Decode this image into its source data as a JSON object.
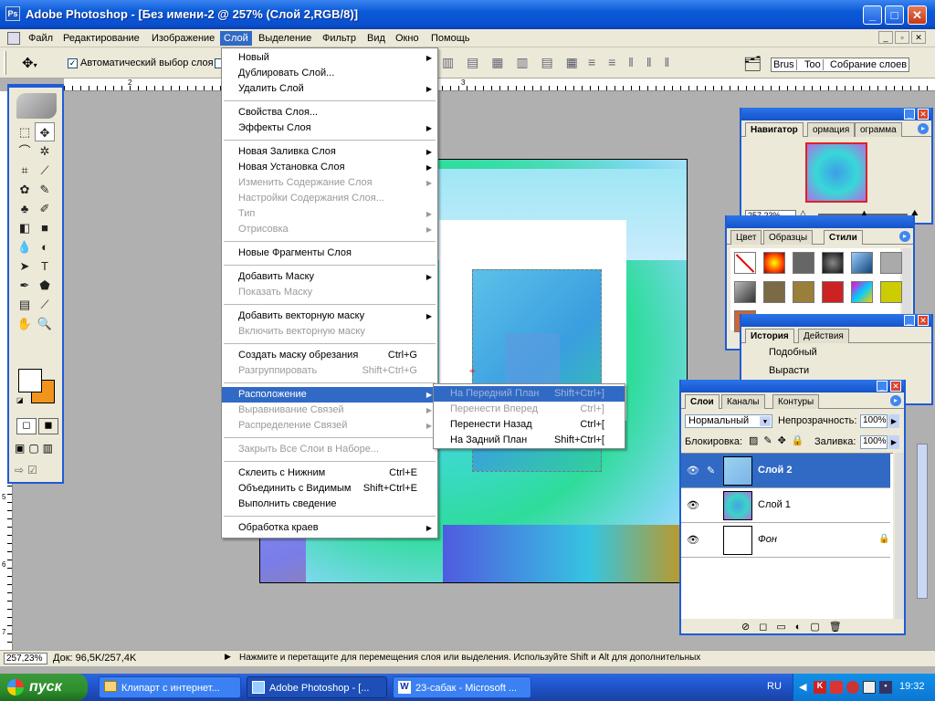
{
  "window": {
    "title": "Adobe Photoshop - [Без имени-2 @ 257% (Слой 2,RGB/8)]",
    "min": "_",
    "max": "□",
    "close": "✕"
  },
  "menubar": {
    "items": [
      "Файл",
      "Редактирование",
      "Изображение",
      "Слой",
      "Выделение",
      "Фильтр",
      "Вид",
      "Окно",
      "Помощь"
    ],
    "active_index": 3
  },
  "options": {
    "auto_select_label": "Автоматический выбор слоя",
    "well_tabs": [
      "Brus",
      "Too",
      "Собрание слоев"
    ]
  },
  "ruler_top": [
    "2",
    "3"
  ],
  "ruler_left": [
    "5",
    "6",
    "7"
  ],
  "layer_menu": {
    "items": [
      {
        "label": "Новый",
        "shortcut": "",
        "sub": true,
        "disabled": false
      },
      {
        "label": "Дублировать Слой...",
        "shortcut": "",
        "sub": false,
        "disabled": false
      },
      {
        "label": "Удалить Слой",
        "shortcut": "",
        "sub": true,
        "disabled": false
      },
      {
        "label": "Свойства Слоя...",
        "shortcut": "",
        "sub": false,
        "disabled": false
      },
      {
        "label": "Эффекты Слоя",
        "shortcut": "",
        "sub": true,
        "disabled": false
      },
      {
        "label": "Новая Заливка Слоя",
        "shortcut": "",
        "sub": true,
        "disabled": false
      },
      {
        "label": "Новая Установка Слоя",
        "shortcut": "",
        "sub": true,
        "disabled": false
      },
      {
        "label": "Изменить Содержание Слоя",
        "shortcut": "",
        "sub": true,
        "disabled": true
      },
      {
        "label": "Настройки Содержания Слоя...",
        "shortcut": "",
        "sub": false,
        "disabled": true
      },
      {
        "label": "Тип",
        "shortcut": "",
        "sub": true,
        "disabled": true
      },
      {
        "label": "Отрисовка",
        "shortcut": "",
        "sub": true,
        "disabled": true
      },
      {
        "label": "Новые Фрагменты Слоя",
        "shortcut": "",
        "sub": false,
        "disabled": false
      },
      {
        "label": "Добавить Маску",
        "shortcut": "",
        "sub": true,
        "disabled": false
      },
      {
        "label": "Показать Маску",
        "shortcut": "",
        "sub": false,
        "disabled": true
      },
      {
        "label": "Добавить векторную маску",
        "shortcut": "",
        "sub": true,
        "disabled": false
      },
      {
        "label": "Включить векторную маску",
        "shortcut": "",
        "sub": false,
        "disabled": true
      },
      {
        "label": "Создать маску обрезания",
        "shortcut": "Ctrl+G",
        "sub": false,
        "disabled": false
      },
      {
        "label": "Разгруппировать",
        "shortcut": "Shift+Ctrl+G",
        "sub": false,
        "disabled": true
      },
      {
        "label": "Расположение",
        "shortcut": "",
        "sub": true,
        "disabled": false,
        "highlight": true
      },
      {
        "label": "Выравнивание Связей",
        "shortcut": "",
        "sub": true,
        "disabled": true
      },
      {
        "label": "Распределение Связей",
        "shortcut": "",
        "sub": true,
        "disabled": true
      },
      {
        "label": "Закрыть Все Слои в Наборе...",
        "shortcut": "",
        "sub": false,
        "disabled": true
      },
      {
        "label": "Склеить с Нижним",
        "shortcut": "Ctrl+E",
        "sub": false,
        "disabled": false
      },
      {
        "label": "Объединить с Видимым",
        "shortcut": "Shift+Ctrl+E",
        "sub": false,
        "disabled": false
      },
      {
        "label": "Выполнить сведение",
        "shortcut": "",
        "sub": false,
        "disabled": false
      },
      {
        "label": "Обработка краев",
        "shortcut": "",
        "sub": true,
        "disabled": false
      }
    ]
  },
  "arrange_submenu": {
    "items": [
      {
        "label": "На Передний План",
        "shortcut": "Shift+Ctrl+]",
        "highlight": true
      },
      {
        "label": "Перенести Вперед",
        "shortcut": "Ctrl+]",
        "disabled": true
      },
      {
        "label": "Перенести Назад",
        "shortcut": "Ctrl+["
      },
      {
        "label": "На Задний План",
        "shortcut": "Shift+Ctrl+["
      }
    ]
  },
  "navigator": {
    "tabs": [
      "Навигатор",
      "ормация",
      "ограмма"
    ],
    "zoom": "257,23%"
  },
  "styles_panel": {
    "tabs": [
      "Цвет",
      "Образцы",
      "Стили"
    ]
  },
  "history": {
    "tabs": [
      "История",
      "Действия"
    ],
    "items": [
      "Подобный",
      "Вырасти"
    ]
  },
  "layers": {
    "tabs": [
      "Слои",
      "Каналы",
      "Контуры"
    ],
    "blend": "Нормальный",
    "opacity_label": "Непрозрачность:",
    "opacity": "100%",
    "lock_label": "Блокировка:",
    "fill_label": "Заливка:",
    "fill": "100%",
    "rows": [
      {
        "name": "Слой 2",
        "selected": true
      },
      {
        "name": "Слой 1",
        "selected": false
      },
      {
        "name": "Фон",
        "selected": false,
        "italic": true,
        "locked": true
      }
    ]
  },
  "status": {
    "zoom": "257,23%",
    "doc": "Док: 96,5K/257,4K",
    "hint": "Нажмите и перетащите для перемещения слоя или выделения. Используйте Shift и Alt для дополнительных"
  },
  "taskbar": {
    "start": "пуск",
    "tasks": [
      "Клипарт с интернет...",
      "Adobe Photoshop - [...",
      "23-сабак - Microsoft ..."
    ],
    "lang": "RU",
    "clock": "19:32"
  }
}
